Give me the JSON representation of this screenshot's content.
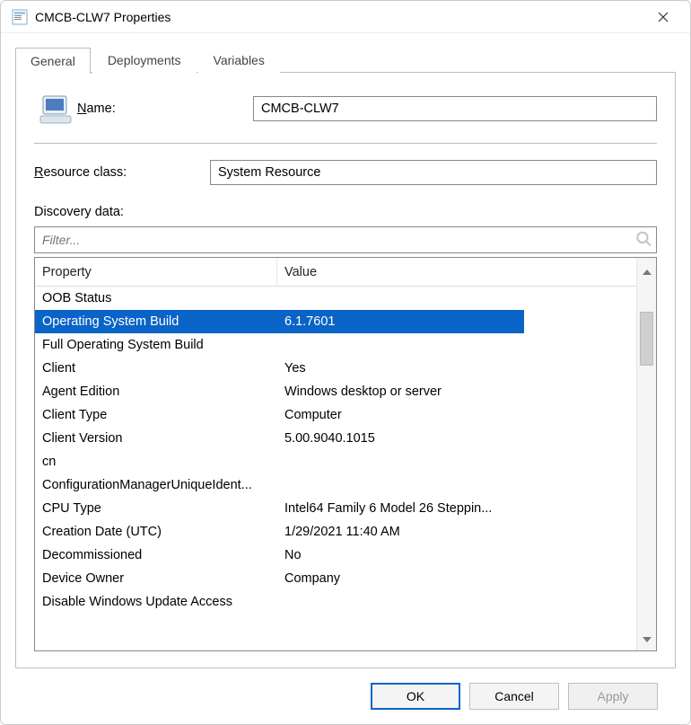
{
  "window": {
    "title": "CMCB-CLW7 Properties"
  },
  "tabs": [
    {
      "label": "General",
      "active": true
    },
    {
      "label": "Deployments",
      "active": false
    },
    {
      "label": "Variables",
      "active": false
    }
  ],
  "fields": {
    "name_label_pre": "N",
    "name_label_post": "ame:",
    "name_value": "CMCB-CLW7",
    "resclass_label_pre": "R",
    "resclass_label_post": "esource class:",
    "resclass_value": "System Resource",
    "discovery_label_pre": "D",
    "discovery_label_post": "iscovery data:"
  },
  "filter": {
    "placeholder": "Filter..."
  },
  "grid": {
    "headers": {
      "col1": "Property",
      "col2": "Value"
    },
    "rows": [
      {
        "property": "OOB Status",
        "value": "",
        "selected": false
      },
      {
        "property": "Operating System Build",
        "value": "6.1.7601",
        "selected": true
      },
      {
        "property": "Full Operating System Build",
        "value": "",
        "selected": false
      },
      {
        "property": "Client",
        "value": "Yes",
        "selected": false
      },
      {
        "property": "Agent Edition",
        "value": "Windows desktop or server",
        "selected": false
      },
      {
        "property": "Client Type",
        "value": "Computer",
        "selected": false
      },
      {
        "property": "Client Version",
        "value": "5.00.9040.1015",
        "selected": false
      },
      {
        "property": "cn",
        "value": "",
        "selected": false
      },
      {
        "property": "ConfigurationManagerUniqueIdent...",
        "value": "",
        "selected": false
      },
      {
        "property": "CPU Type",
        "value": "Intel64 Family 6 Model 26 Steppin...",
        "selected": false
      },
      {
        "property": "Creation Date (UTC)",
        "value": "1/29/2021 11:40 AM",
        "selected": false
      },
      {
        "property": "Decommissioned",
        "value": "No",
        "selected": false
      },
      {
        "property": "Device Owner",
        "value": "Company",
        "selected": false
      },
      {
        "property": "Disable Windows Update Access",
        "value": "",
        "selected": false
      }
    ]
  },
  "buttons": {
    "ok": "OK",
    "cancel": "Cancel",
    "apply": "Apply"
  }
}
